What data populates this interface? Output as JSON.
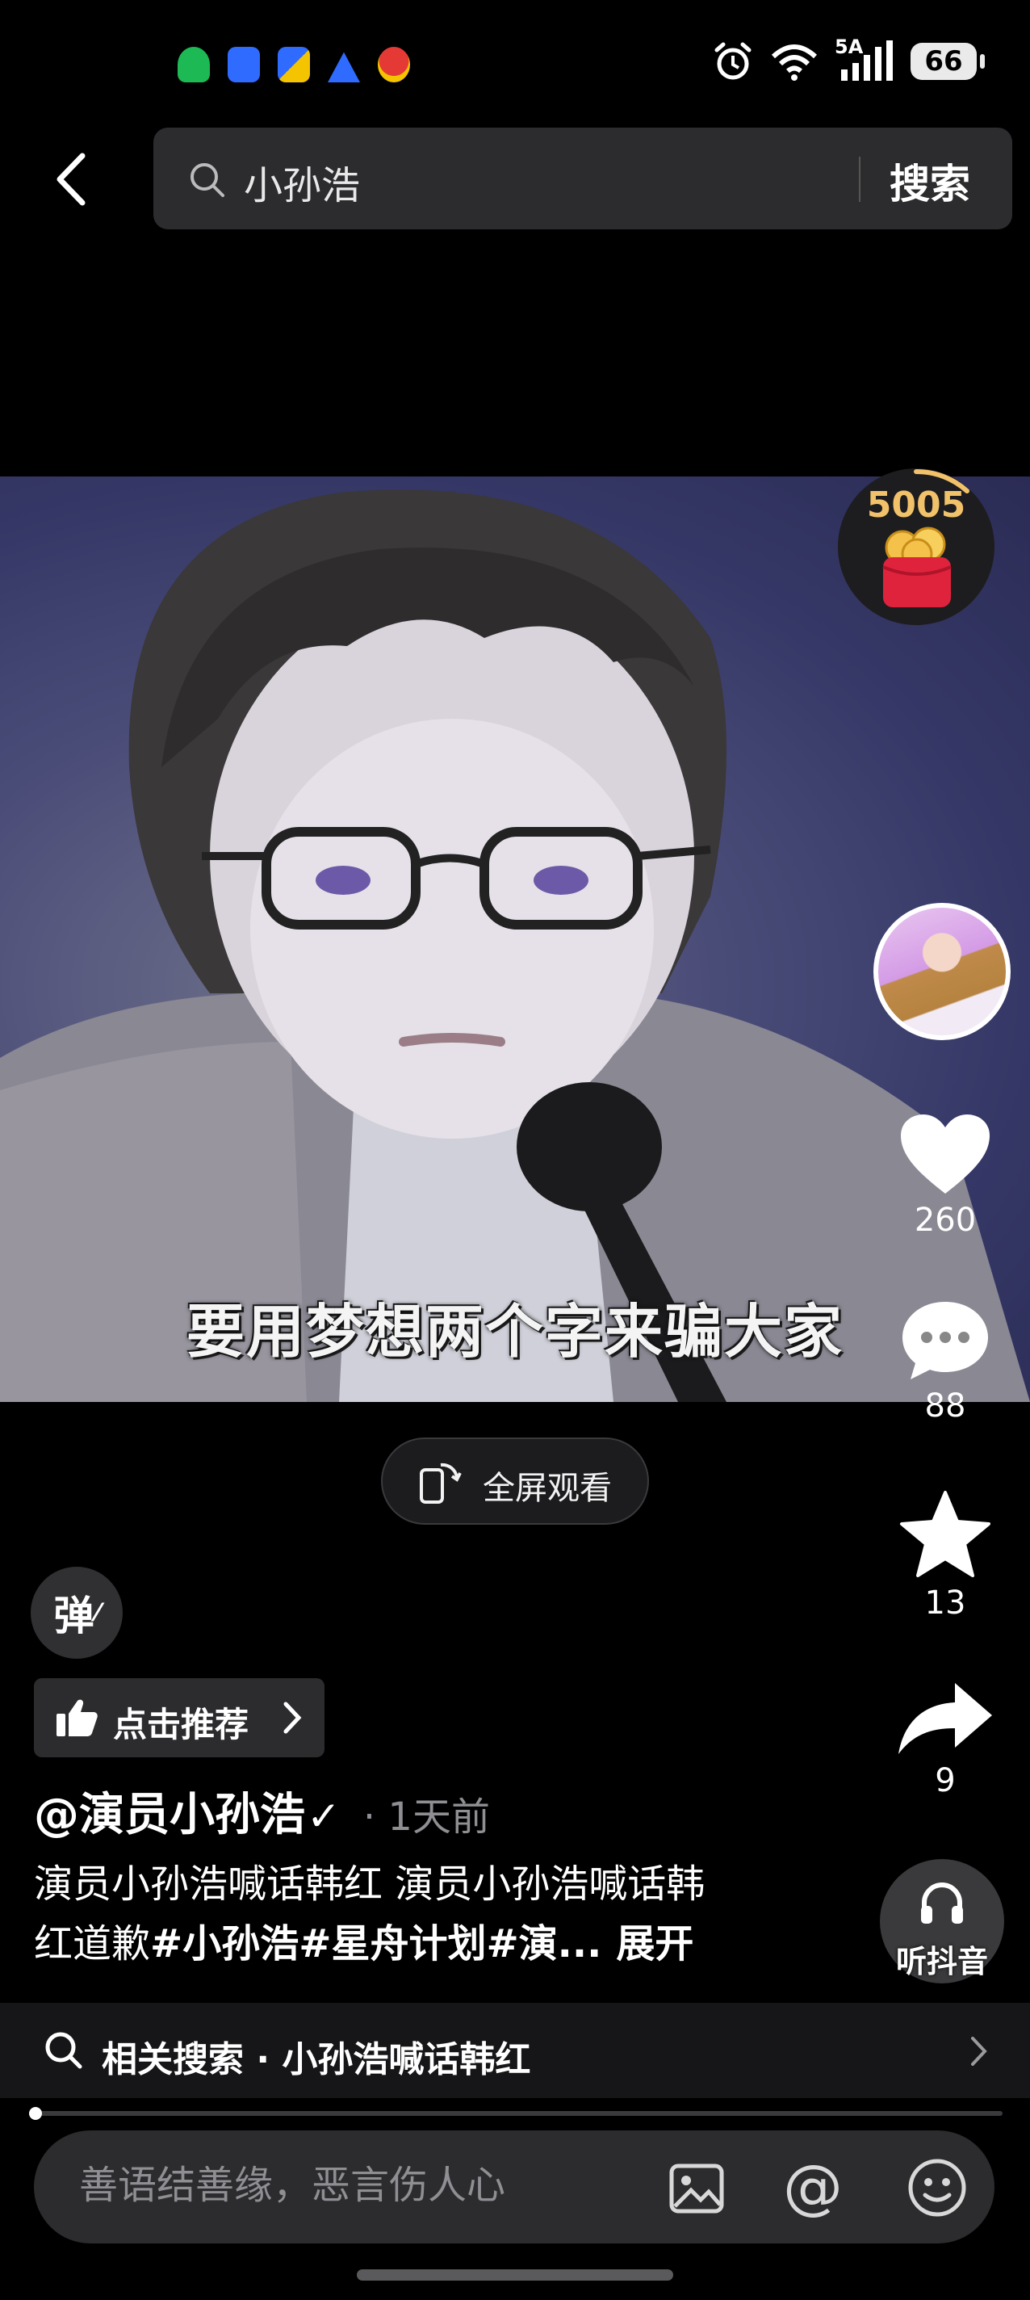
{
  "status_bar": {
    "network": "5A",
    "battery": "66",
    "notification_icons": [
      "green-app-icon",
      "blue-app-icon",
      "blue-yellow-app-icon",
      "blue-triangle-app-icon",
      "red-app-icon"
    ],
    "colors": {
      "green": "#1db954",
      "blue": "#2f6bff",
      "yellow": "#f5c400",
      "red": "#e53935"
    }
  },
  "search": {
    "query": "小孙浩",
    "submit_label": "搜索"
  },
  "video": {
    "subtitle": "要用梦想两个字来骗大家"
  },
  "sidebar": {
    "reward_count": "5005",
    "likes": "260",
    "comments": "88",
    "favorites": "13",
    "shares": "9",
    "listen_label": "听抖音"
  },
  "fullscreen_label": "全屏观看",
  "danmaku_label": "弹",
  "recommend_label": "点击推荐",
  "post": {
    "author": "@演员小孙浩",
    "verified": "✓",
    "time": "· 1天前",
    "caption_line1": "演员小孙浩喊话韩红 演员小孙浩喊话韩",
    "caption_line2_plain": "红道歉",
    "caption_tags": "#小孙浩#星舟计划#演...",
    "expand_label": "展开"
  },
  "related_search": {
    "label": "相关搜索 · 小孙浩喊话韩红"
  },
  "playback": {
    "progress_fraction": 0.002
  },
  "comment": {
    "placeholder": "善语结善缘，恶言伤人心",
    "at_symbol": "@"
  },
  "colors": {
    "background": "#000000",
    "accent_gold": "#f2c26b",
    "reward_red": "#e0233c"
  }
}
